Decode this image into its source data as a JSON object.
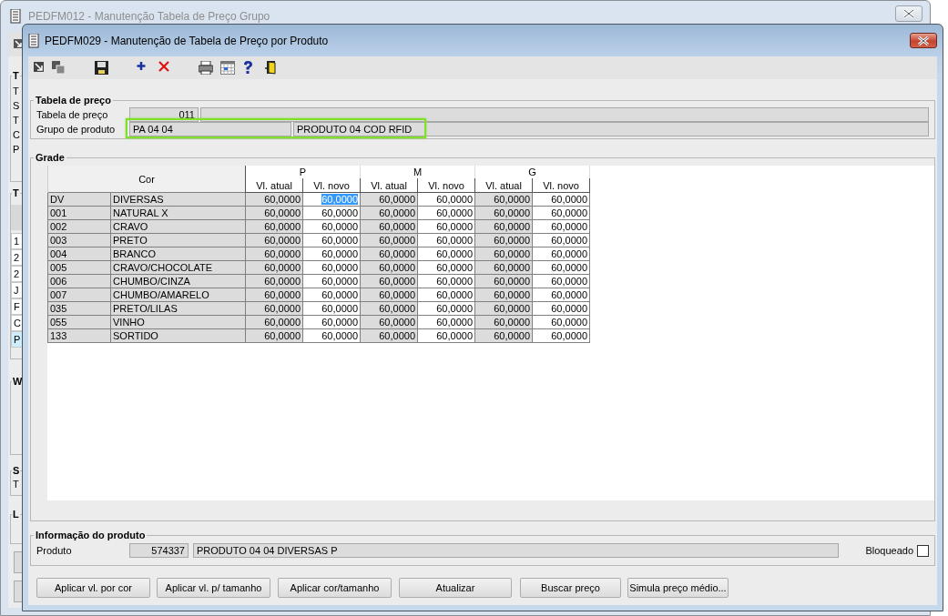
{
  "background_window": {
    "title": "PEDFM012 - Manutenção Tabela de Preço Grupo",
    "groups": [
      {
        "title": "T",
        "lines": [
          "T",
          "S",
          "T",
          "C",
          "P"
        ]
      },
      {
        "title": "T",
        "list": [
          {
            "text": "1",
            "selected": false
          },
          {
            "text": "2",
            "selected": false
          },
          {
            "text": "2",
            "selected": false
          },
          {
            "text": "J",
            "selected": false
          },
          {
            "text": "F",
            "selected": false
          },
          {
            "text": "C",
            "selected": false
          },
          {
            "text": "P",
            "selected": true
          }
        ]
      },
      {
        "title": "W"
      },
      {
        "title": "S",
        "lines": [
          "T"
        ]
      },
      {
        "title": "L"
      }
    ]
  },
  "window": {
    "title": "PEDFM029 - Manutenção de Tabela de Preço por Produto"
  },
  "price_table": {
    "title": "Tabela de preço",
    "fields": [
      {
        "label": "Tabela de preço",
        "code": "011",
        "highlighted": false
      },
      {
        "label": "Grupo de produto",
        "code": "PA 04 04",
        "description": "PRODUTO 04 COD RFID",
        "highlighted": true
      }
    ]
  },
  "grid": {
    "title": "Grade",
    "color_header": "Cor",
    "sizes": [
      {
        "label": "P",
        "columns": [
          {
            "label": "Vl. atual",
            "editable": false
          },
          {
            "label": "Vl. novo",
            "editable": true
          }
        ]
      },
      {
        "label": "M",
        "columns": [
          {
            "label": "Vl. atual",
            "editable": false
          },
          {
            "label": "Vl. novo",
            "editable": true
          }
        ]
      },
      {
        "label": "G",
        "columns": [
          {
            "label": "Vl. atual",
            "editable": false
          },
          {
            "label": "Vl. novo",
            "editable": true
          }
        ]
      }
    ],
    "rows": [
      {
        "code": "DV",
        "name": "DIVERSAS",
        "cells": [
          {
            "value": "60,0000",
            "selected": false
          },
          {
            "value": "60,0000",
            "selected": true
          },
          {
            "value": "60,0000",
            "selected": false
          },
          {
            "value": "60,0000",
            "selected": false
          },
          {
            "value": "60,0000",
            "selected": false
          },
          {
            "value": "60,0000",
            "selected": false
          }
        ]
      },
      {
        "code": "001",
        "name": "NATURAL X",
        "cells": [
          {
            "value": "60,0000",
            "selected": false
          },
          {
            "value": "60,0000",
            "selected": false
          },
          {
            "value": "60,0000",
            "selected": false
          },
          {
            "value": "60,0000",
            "selected": false
          },
          {
            "value": "60,0000",
            "selected": false
          },
          {
            "value": "60,0000",
            "selected": false
          }
        ]
      },
      {
        "code": "002",
        "name": "CRAVO",
        "cells": [
          {
            "value": "60,0000",
            "selected": false
          },
          {
            "value": "60,0000",
            "selected": false
          },
          {
            "value": "60,0000",
            "selected": false
          },
          {
            "value": "60,0000",
            "selected": false
          },
          {
            "value": "60,0000",
            "selected": false
          },
          {
            "value": "60,0000",
            "selected": false
          }
        ]
      },
      {
        "code": "003",
        "name": "PRETO",
        "cells": [
          {
            "value": "60,0000",
            "selected": false
          },
          {
            "value": "60,0000",
            "selected": false
          },
          {
            "value": "60,0000",
            "selected": false
          },
          {
            "value": "60,0000",
            "selected": false
          },
          {
            "value": "60,0000",
            "selected": false
          },
          {
            "value": "60,0000",
            "selected": false
          }
        ]
      },
      {
        "code": "004",
        "name": "BRANCO",
        "cells": [
          {
            "value": "60,0000",
            "selected": false
          },
          {
            "value": "60,0000",
            "selected": false
          },
          {
            "value": "60,0000",
            "selected": false
          },
          {
            "value": "60,0000",
            "selected": false
          },
          {
            "value": "60,0000",
            "selected": false
          },
          {
            "value": "60,0000",
            "selected": false
          }
        ]
      },
      {
        "code": "005",
        "name": "CRAVO/CHOCOLATE",
        "cells": [
          {
            "value": "60,0000",
            "selected": false
          },
          {
            "value": "60,0000",
            "selected": false
          },
          {
            "value": "60,0000",
            "selected": false
          },
          {
            "value": "60,0000",
            "selected": false
          },
          {
            "value": "60,0000",
            "selected": false
          },
          {
            "value": "60,0000",
            "selected": false
          }
        ]
      },
      {
        "code": "006",
        "name": "CHUMBO/CINZA",
        "cells": [
          {
            "value": "60,0000",
            "selected": false
          },
          {
            "value": "60,0000",
            "selected": false
          },
          {
            "value": "60,0000",
            "selected": false
          },
          {
            "value": "60,0000",
            "selected": false
          },
          {
            "value": "60,0000",
            "selected": false
          },
          {
            "value": "60,0000",
            "selected": false
          }
        ]
      },
      {
        "code": "007",
        "name": "CHUMBO/AMARELO",
        "cells": [
          {
            "value": "60,0000",
            "selected": false
          },
          {
            "value": "60,0000",
            "selected": false
          },
          {
            "value": "60,0000",
            "selected": false
          },
          {
            "value": "60,0000",
            "selected": false
          },
          {
            "value": "60,0000",
            "selected": false
          },
          {
            "value": "60,0000",
            "selected": false
          }
        ]
      },
      {
        "code": "035",
        "name": "PRETO/LILAS",
        "cells": [
          {
            "value": "60,0000",
            "selected": false
          },
          {
            "value": "60,0000",
            "selected": false
          },
          {
            "value": "60,0000",
            "selected": false
          },
          {
            "value": "60,0000",
            "selected": false
          },
          {
            "value": "60,0000",
            "selected": false
          },
          {
            "value": "60,0000",
            "selected": false
          }
        ]
      },
      {
        "code": "055",
        "name": "VINHO",
        "cells": [
          {
            "value": "60,0000",
            "selected": false
          },
          {
            "value": "60,0000",
            "selected": false
          },
          {
            "value": "60,0000",
            "selected": false
          },
          {
            "value": "60,0000",
            "selected": false
          },
          {
            "value": "60,0000",
            "selected": false
          },
          {
            "value": "60,0000",
            "selected": false
          }
        ]
      },
      {
        "code": "133",
        "name": "SORTIDO",
        "cells": [
          {
            "value": "60,0000",
            "selected": false
          },
          {
            "value": "60,0000",
            "selected": false
          },
          {
            "value": "60,0000",
            "selected": false
          },
          {
            "value": "60,0000",
            "selected": false
          },
          {
            "value": "60,0000",
            "selected": false
          },
          {
            "value": "60,0000",
            "selected": false
          }
        ]
      }
    ]
  },
  "product_info": {
    "title": "Informação do produto",
    "label": "Produto",
    "code": "574337",
    "description": "PRODUTO 04 04 DIVERSAS P",
    "blocked_label": "Bloqueado",
    "blocked": false
  },
  "buttons": [
    "Aplicar vl. por cor",
    "Aplicar vl. p/ tamanho",
    "Aplicar cor/tamanho",
    "Atualizar",
    "Buscar preço",
    "Simula preço médio..."
  ]
}
